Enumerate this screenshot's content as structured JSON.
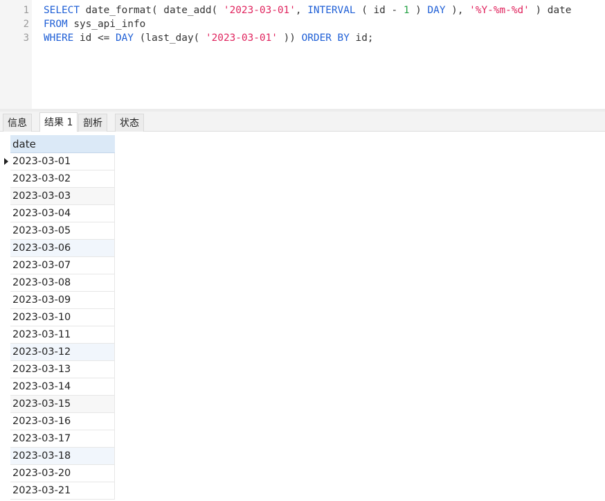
{
  "editor": {
    "line_numbers": [
      "1",
      "2",
      "3"
    ],
    "lines": [
      [
        {
          "t": "SELECT",
          "c": "kw"
        },
        {
          "t": " date_format( date_add( ",
          "c": ""
        },
        {
          "t": "'2023-03-01'",
          "c": "str"
        },
        {
          "t": ", ",
          "c": ""
        },
        {
          "t": "INTERVAL",
          "c": "kw"
        },
        {
          "t": " ( id - ",
          "c": ""
        },
        {
          "t": "1",
          "c": "num"
        },
        {
          "t": " ) ",
          "c": ""
        },
        {
          "t": "DAY",
          "c": "kw"
        },
        {
          "t": " ), ",
          "c": ""
        },
        {
          "t": "'%Y-%m-%d'",
          "c": "str"
        },
        {
          "t": " ) date",
          "c": ""
        }
      ],
      [
        {
          "t": "FROM",
          "c": "kw"
        },
        {
          "t": " sys_api_info",
          "c": ""
        }
      ],
      [
        {
          "t": "WHERE",
          "c": "kw"
        },
        {
          "t": " id <= ",
          "c": ""
        },
        {
          "t": "DAY",
          "c": "kw"
        },
        {
          "t": " (last_day( ",
          "c": ""
        },
        {
          "t": "'2023-03-01'",
          "c": "str"
        },
        {
          "t": " )) ",
          "c": ""
        },
        {
          "t": "ORDER BY",
          "c": "kw"
        },
        {
          "t": " id;",
          "c": ""
        }
      ]
    ]
  },
  "tabs": [
    {
      "label": "信息",
      "active": false
    },
    {
      "label": "结果 1",
      "active": true
    },
    {
      "label": "剖析",
      "active": false
    },
    {
      "label": "状态",
      "active": false
    }
  ],
  "result": {
    "column": "date",
    "rows": [
      "2023-03-01",
      "2023-03-02",
      "2023-03-03",
      "2023-03-04",
      "2023-03-05",
      "2023-03-06",
      "2023-03-07",
      "2023-03-08",
      "2023-03-09",
      "2023-03-10",
      "2023-03-11",
      "2023-03-12",
      "2023-03-13",
      "2023-03-14",
      "2023-03-15",
      "2023-03-16",
      "2023-03-17",
      "2023-03-18",
      "2023-03-20",
      "2023-03-21"
    ],
    "current_row": 0
  },
  "colors": {
    "keyword": "#1f5fd6",
    "string": "#e0245e",
    "number": "#25a245",
    "header_bg": "#dbe9f7"
  },
  "icons": {
    "row_pointer": "row-pointer-icon"
  }
}
